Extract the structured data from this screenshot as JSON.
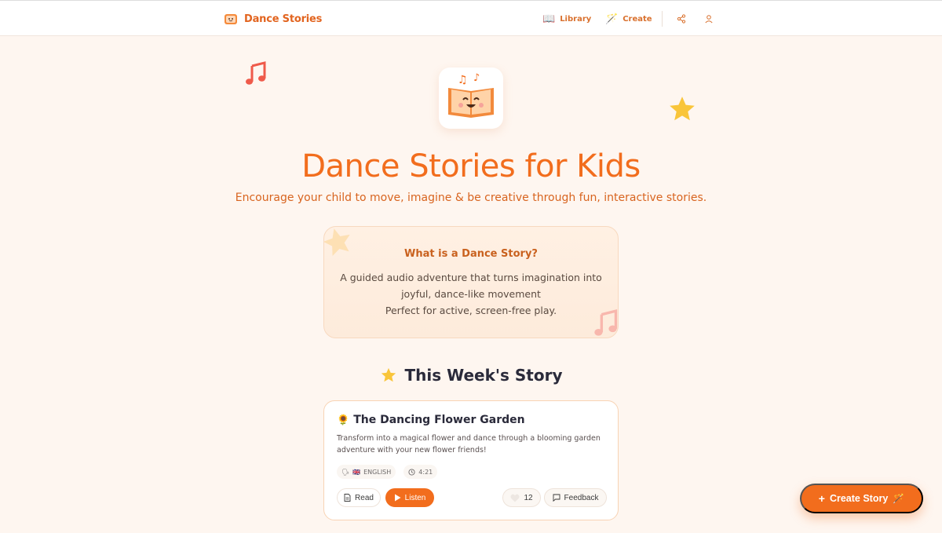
{
  "header": {
    "brand_name": "Dance Stories",
    "nav": {
      "library_label": "Library",
      "create_label": "Create"
    }
  },
  "hero": {
    "title": "Dance Stories for Kids",
    "subtitle": "Encourage your child to move, imagine & be creative through fun, interactive stories."
  },
  "info": {
    "heading": "What is a Dance Story?",
    "line1": "A guided audio adventure that turns imagination into",
    "line2": "joyful, dance-like movement",
    "line3": "Perfect for active, screen-free play."
  },
  "week": {
    "heading": "This Week's Story"
  },
  "story": {
    "title": "The Dancing Flower Garden",
    "description": "Transform into a magical flower and dance through a blooming garden adventure with your new flower friends!",
    "language": "ENGLISH",
    "duration": "4:21",
    "read_label": "Read",
    "listen_label": "Listen",
    "likes": "12",
    "feedback_label": "Feedback"
  },
  "fab": {
    "label": "Create Story"
  },
  "colors": {
    "accent": "#f26d1d",
    "background": "#fef6f0",
    "heading_dark": "#2a2a3a",
    "star": "#f9c53a",
    "note": "#ef5a4a"
  }
}
